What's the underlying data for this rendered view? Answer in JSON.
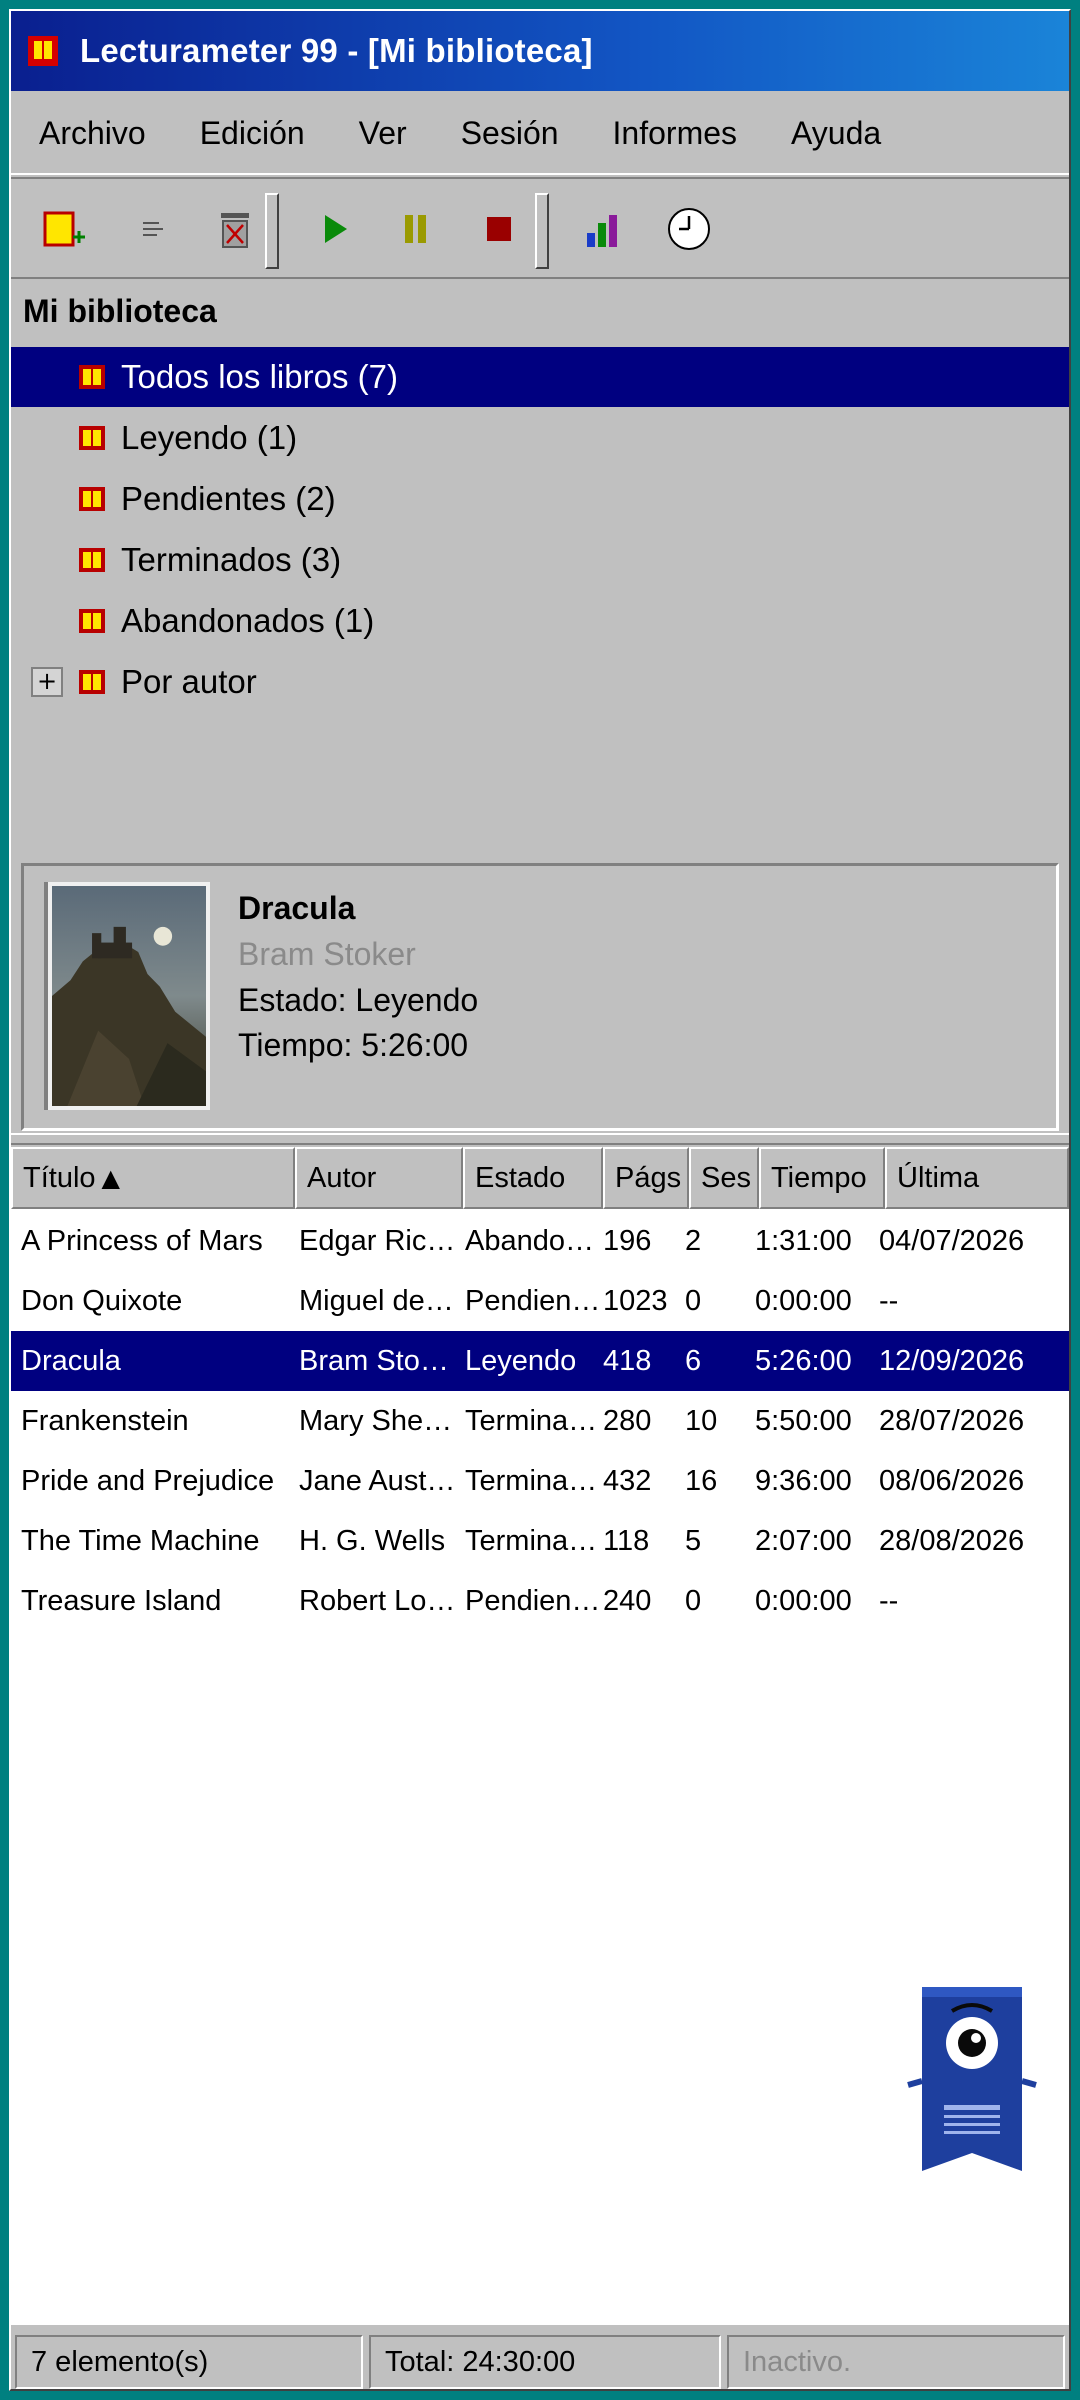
{
  "window": {
    "title": "Lecturameter 99 - [Mi biblioteca]"
  },
  "menu": [
    "Archivo",
    "Edición",
    "Ver",
    "Sesión",
    "Informes",
    "Ayuda"
  ],
  "toolbar": {
    "buttons": [
      "new-book",
      "properties",
      "delete",
      "start-session",
      "pause-session",
      "stop-session",
      "reports",
      "history"
    ]
  },
  "tree": {
    "header": "Mi biblioteca",
    "items": [
      {
        "label": "Todos los libros (7)",
        "selected": true
      },
      {
        "label": "Leyendo (1)"
      },
      {
        "label": "Pendientes (2)"
      },
      {
        "label": "Terminados (3)"
      },
      {
        "label": "Abandonados (1)"
      },
      {
        "label": "Por autor",
        "expander": "+"
      }
    ]
  },
  "preview": {
    "title": "Dracula",
    "author": "Bram Stoker",
    "status": "Estado: Leyendo",
    "time": "Tiempo: 5:26:00"
  },
  "list": {
    "columns": [
      "Título",
      "Autor",
      "Estado",
      "Págs",
      "Ses",
      "Tiempo",
      "Última"
    ],
    "sort_indicator": "▲",
    "rows": [
      [
        "A Princess of Mars",
        "Edgar Ric…",
        "Abando…",
        "196",
        "2",
        "1:31:00",
        "04/07/2026"
      ],
      [
        "Don Quixote",
        "Miguel de …",
        "Pendien…",
        "1023",
        "0",
        "0:00:00",
        "--"
      ],
      [
        "Dracula",
        "Bram Stok…",
        "Leyendo",
        "418",
        "6",
        "5:26:00",
        "12/09/2026"
      ],
      [
        "Frankenstein",
        "Mary Shell…",
        "Termina…",
        "280",
        "10",
        "5:50:00",
        "28/07/2026"
      ],
      [
        "Pride and Prejudice",
        "Jane Aust…",
        "Termina…",
        "432",
        "16",
        "9:36:00",
        "08/06/2026"
      ],
      [
        "The Time Machine",
        "H. G. Wells",
        "Termina…",
        "118",
        "5",
        "2:07:00",
        "28/08/2026"
      ],
      [
        "Treasure Island",
        "Robert Lo…",
        "Pendien…",
        "240",
        "0",
        "0:00:00",
        "--"
      ]
    ],
    "selected_row": 2
  },
  "status": {
    "count": "7 elemento(s)",
    "total": "Total: 24:30:00",
    "state": "Inactivo."
  },
  "colors": {
    "desktop": "#008080",
    "face": "#c0c0c0",
    "selection": "#000080",
    "mascot": "#1e3f9e"
  }
}
